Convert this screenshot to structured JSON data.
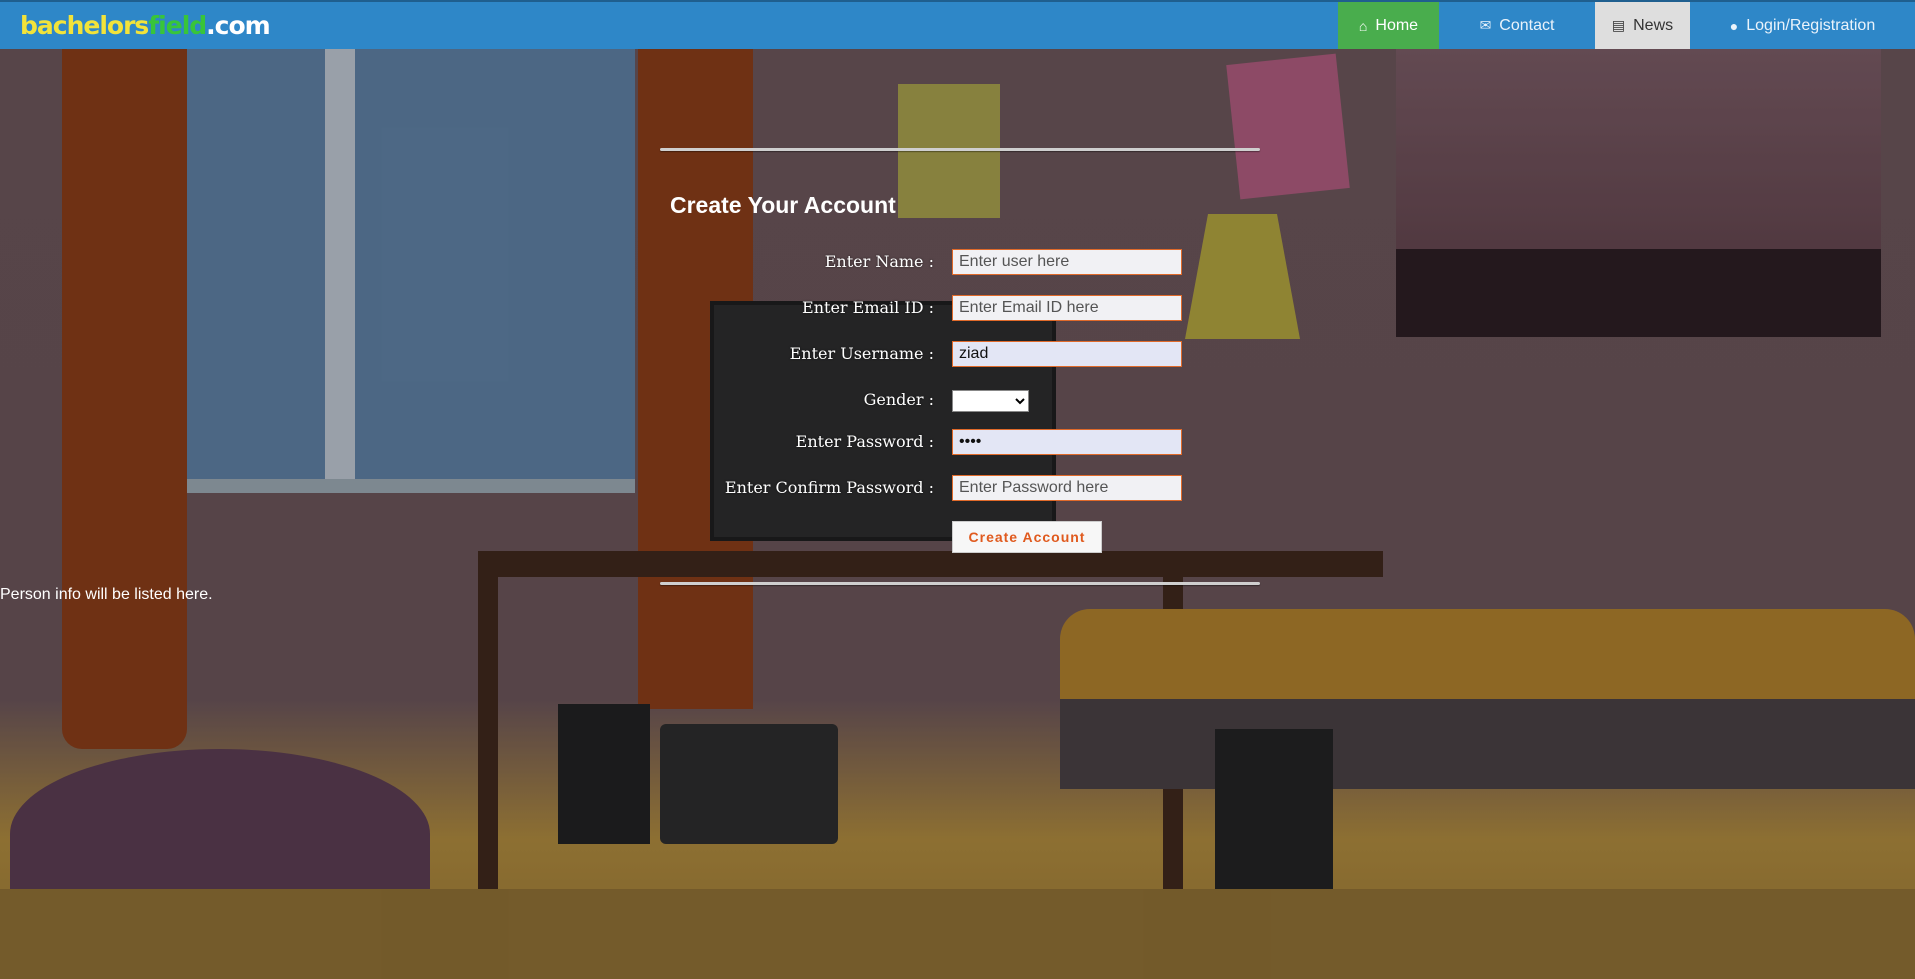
{
  "brand": {
    "part1": "bachelors",
    "part2": "field",
    "part3": ".com"
  },
  "nav": {
    "home": {
      "icon": "home-icon",
      "label": "Home"
    },
    "contact": {
      "icon": "envelope-icon",
      "label": "Contact"
    },
    "news": {
      "icon": "newspaper-icon",
      "label": "News"
    },
    "login": {
      "icon": "user-icon",
      "label": "Login/Registration"
    }
  },
  "form": {
    "title": "Create Your Account",
    "name": {
      "label": "Enter Name :",
      "placeholder": "Enter user here",
      "value": ""
    },
    "email": {
      "label": "Enter Email ID :",
      "placeholder": "Enter Email ID here",
      "value": ""
    },
    "username": {
      "label": "Enter Username :",
      "placeholder": "",
      "value": "ziad"
    },
    "gender": {
      "label": "Gender :",
      "selected": ""
    },
    "password": {
      "label": "Enter Password :",
      "value": "abcd"
    },
    "confirm": {
      "label": "Enter Confirm Password :",
      "placeholder": "Enter Password here",
      "value": ""
    },
    "submit_label": "Create Account"
  },
  "person_info": "Person info will be listed here.",
  "colors": {
    "navbar": "#2e87c8",
    "home_active": "#49ad4d",
    "news_bg": "#dedede",
    "button_text": "#e05a1e",
    "input_border": "#e06a2a"
  }
}
